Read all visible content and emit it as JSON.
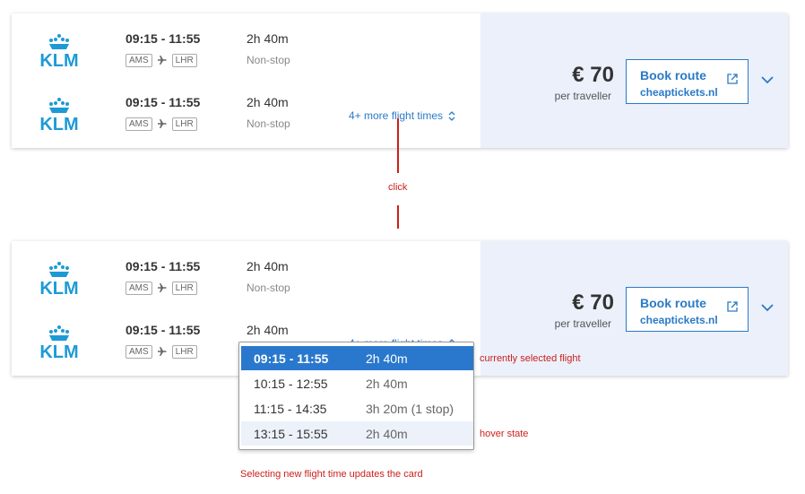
{
  "cards": [
    {
      "legs": [
        {
          "airline": "KLM",
          "times": "09:15 - 11:55",
          "from": "AMS",
          "to": "LHR",
          "duration": "2h 40m",
          "stops": "Non-stop"
        },
        {
          "airline": "KLM",
          "times": "09:15 - 11:55",
          "from": "AMS",
          "to": "LHR",
          "duration": "2h 40m",
          "stops": "Non-stop",
          "more_link": "4+ more flight times"
        }
      ],
      "price": "€ 70",
      "price_sub": "per traveller",
      "book": {
        "label": "Book route",
        "site": "cheaptickets.nl"
      }
    },
    {
      "legs": [
        {
          "airline": "KLM",
          "times": "09:15 - 11:55",
          "from": "AMS",
          "to": "LHR",
          "duration": "2h 40m",
          "stops": "Non-stop"
        },
        {
          "airline": "KLM",
          "times": "09:15 - 11:55",
          "from": "AMS",
          "to": "LHR",
          "duration": "2h 40m",
          "more_link": "4+ more flight times"
        }
      ],
      "price": "€ 70",
      "price_sub": "per traveller",
      "book": {
        "label": "Book route",
        "site": "cheaptickets.nl"
      }
    }
  ],
  "dropdown": {
    "options": [
      {
        "times": "09:15 - 11:55",
        "duration": "2h 40m",
        "state": "selected"
      },
      {
        "times": "10:15 - 12:55",
        "duration": "2h 40m",
        "state": "normal"
      },
      {
        "times": "11:15 - 14:35",
        "duration": "3h 20m (1 stop)",
        "state": "normal"
      },
      {
        "times": "13:15 - 15:55",
        "duration": "2h 40m",
        "state": "hover"
      }
    ]
  },
  "annotations": {
    "click": "click",
    "selected": "currently selected flight",
    "hover": "hover state",
    "caption": "Selecting new flight time updates the card"
  },
  "colors": {
    "accent": "#2a7ac6",
    "klm_blue": "#1d9ad6",
    "annotation": "#cc1f1a",
    "price_panel": "#ebf0fb"
  },
  "icons": [
    "klm-logo",
    "plane-icon",
    "external-link-icon",
    "chevron-down-icon",
    "up-down-chevron-icon"
  ]
}
